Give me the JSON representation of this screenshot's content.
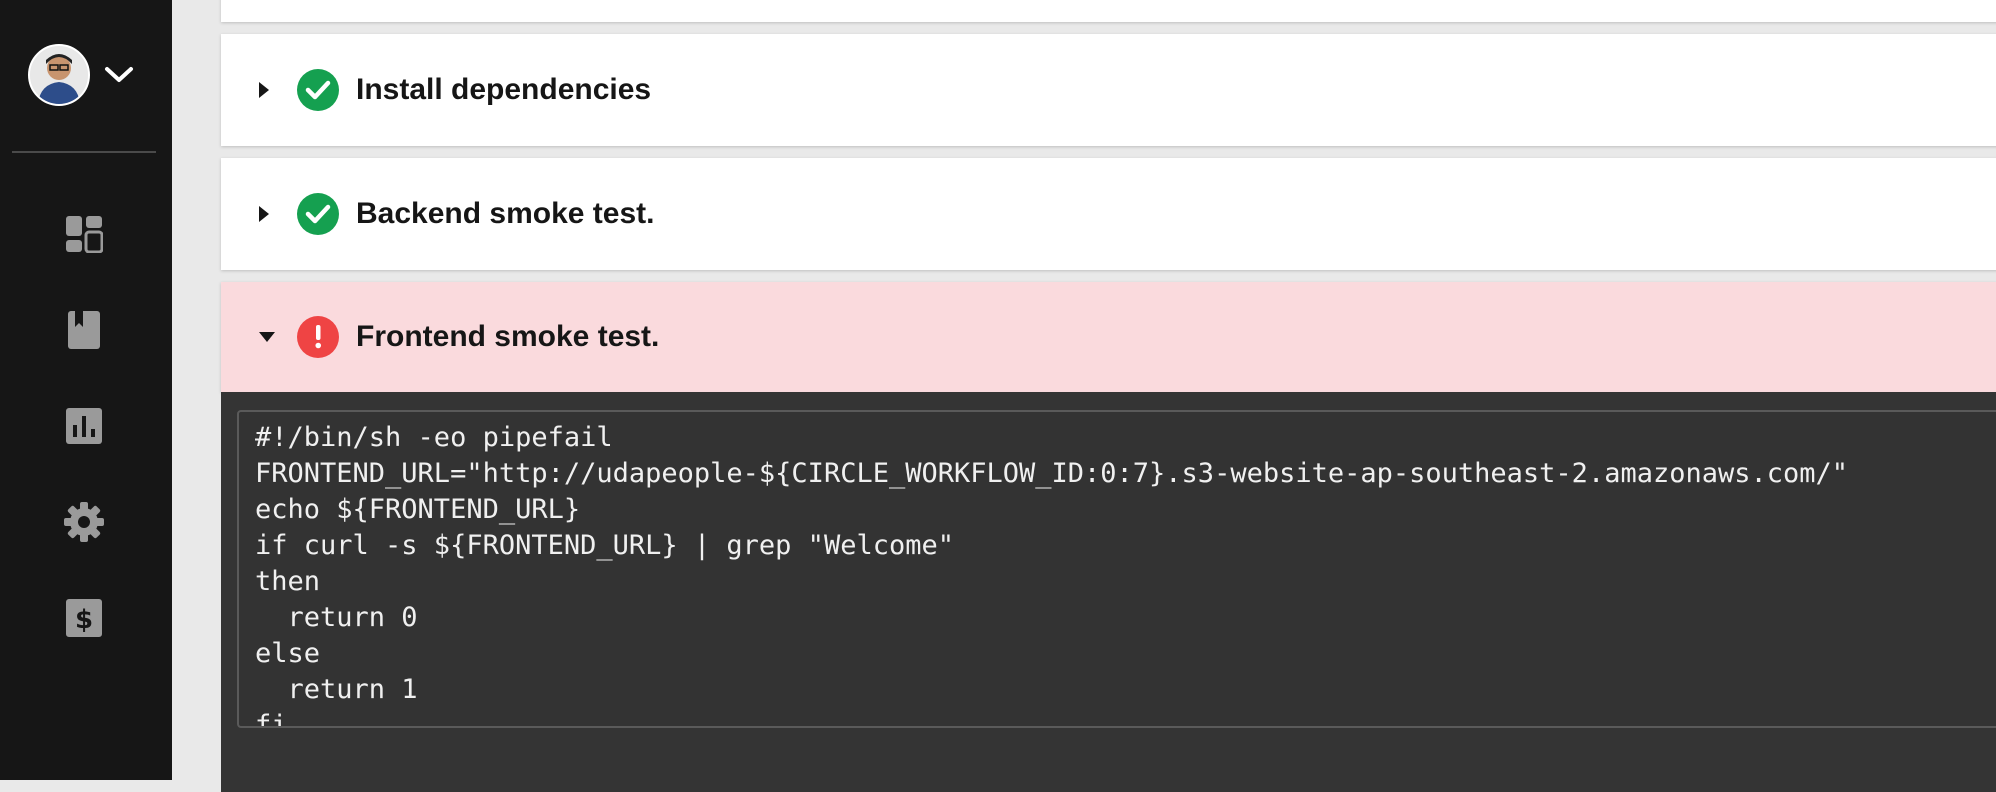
{
  "colors": {
    "sidebar_bg": "#161616",
    "success_green": "#15a050",
    "failure_red": "#ef4444",
    "failed_row_bg": "#fadadd",
    "terminal_bg": "#333333"
  },
  "sidebar": {
    "avatar": "user-avatar",
    "menu_icon": "chevron-down-icon",
    "items": [
      {
        "name": "dashboard",
        "icon": "dashboard-icon"
      },
      {
        "name": "projects",
        "icon": "book-icon"
      },
      {
        "name": "insights",
        "icon": "bar-chart-icon"
      },
      {
        "name": "settings",
        "icon": "gear-icon"
      },
      {
        "name": "plan",
        "icon": "dollar-icon"
      }
    ]
  },
  "steps": [
    {
      "title": "Install dependencies",
      "status": "success",
      "expanded": false
    },
    {
      "title": "Backend smoke test.",
      "status": "success",
      "expanded": false
    },
    {
      "title": "Frontend smoke test.",
      "status": "failed",
      "expanded": true
    }
  ],
  "terminal": {
    "lines": [
      "#!/bin/sh -eo pipefail",
      "FRONTEND_URL=\"http://udapeople-${CIRCLE_WORKFLOW_ID:0:7}.s3-website-ap-southeast-2.amazonaws.com/\"",
      "echo ${FRONTEND_URL}",
      "if curl -s ${FRONTEND_URL} | grep \"Welcome\"",
      "then",
      "  return 0",
      "else",
      "  return 1",
      "fi"
    ]
  }
}
